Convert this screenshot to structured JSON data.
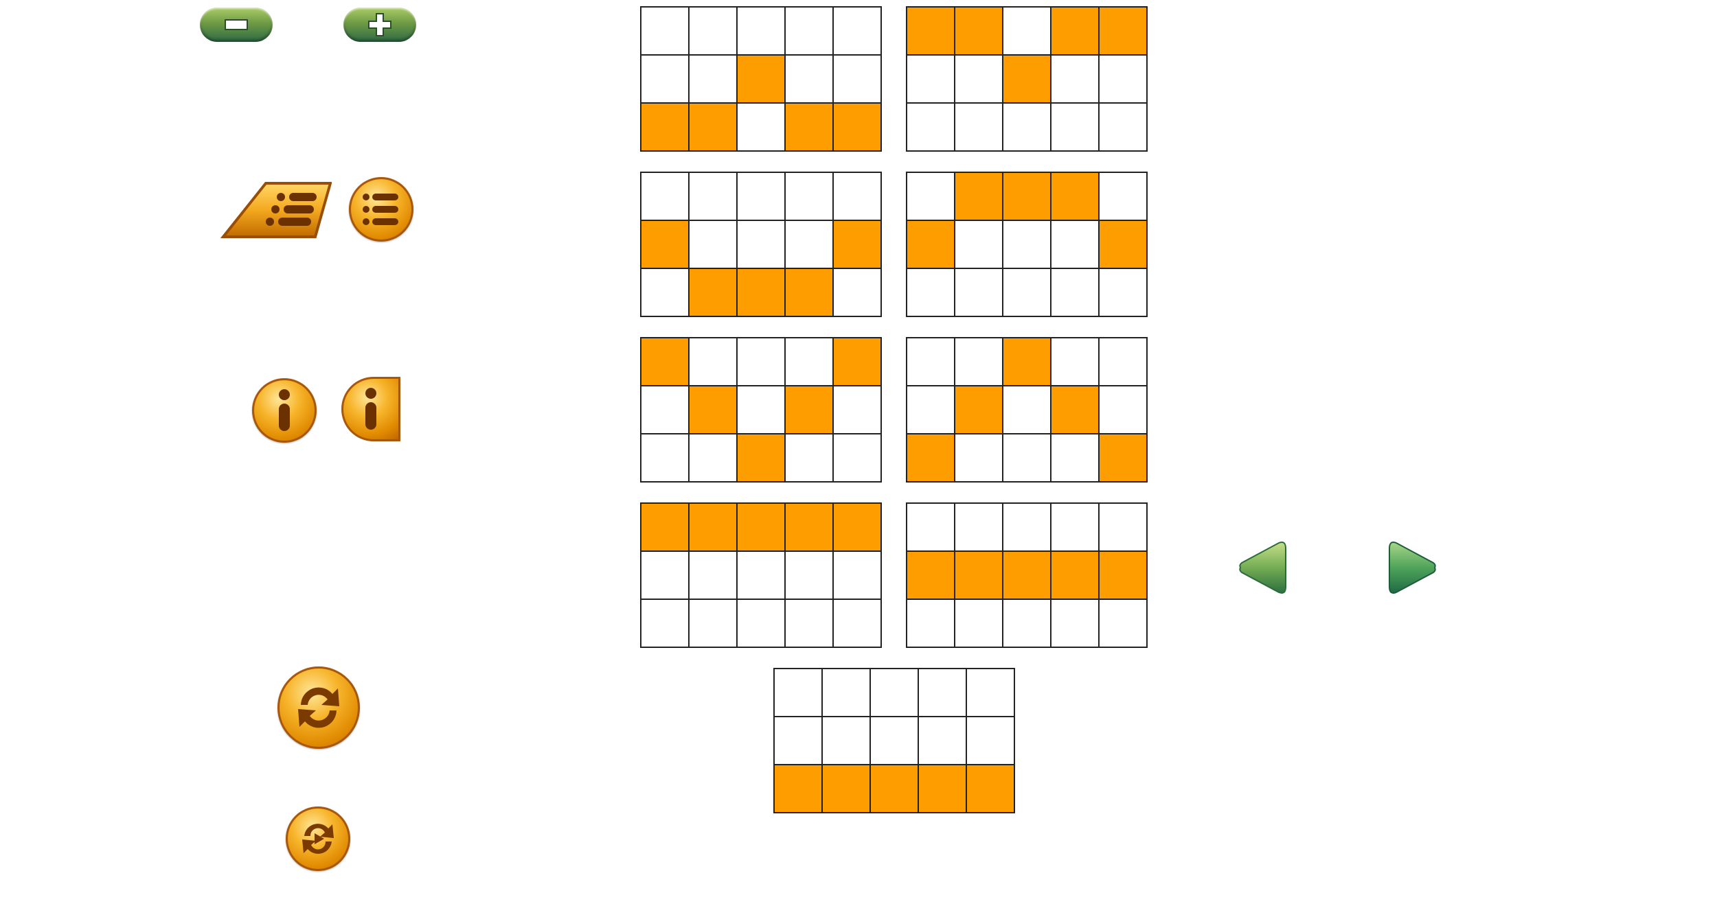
{
  "colors": {
    "filled": "#fe9d00",
    "empty": "#ffffff",
    "grid_line": "#222222",
    "nav_green": "#4e9a4a",
    "orb_orange": "#f3a323"
  },
  "controls": {
    "zoom_out": {
      "icon": "minus-icon"
    },
    "zoom_in": {
      "icon": "plus-icon"
    },
    "menu_tab": {
      "icon": "list-icon"
    },
    "menu_round": {
      "icon": "list-icon"
    },
    "info_round": {
      "icon": "info-icon"
    },
    "info_tab": {
      "icon": "info-icon"
    },
    "refresh_large": {
      "icon": "refresh-icon"
    },
    "refresh_small": {
      "icon": "refresh-icon"
    },
    "prev": {
      "icon": "arrow-left-icon"
    },
    "next": {
      "icon": "arrow-right-icon"
    }
  },
  "paylines": [
    {
      "id": 1,
      "rows": [
        [
          0,
          0,
          0,
          0,
          0
        ],
        [
          0,
          0,
          1,
          0,
          0
        ],
        [
          1,
          1,
          0,
          1,
          1
        ]
      ]
    },
    {
      "id": 2,
      "rows": [
        [
          1,
          1,
          0,
          1,
          1
        ],
        [
          0,
          0,
          1,
          0,
          0
        ],
        [
          0,
          0,
          0,
          0,
          0
        ]
      ]
    },
    {
      "id": 3,
      "rows": [
        [
          0,
          0,
          0,
          0,
          0
        ],
        [
          1,
          0,
          0,
          0,
          1
        ],
        [
          0,
          1,
          1,
          1,
          0
        ]
      ]
    },
    {
      "id": 4,
      "rows": [
        [
          0,
          1,
          1,
          1,
          0
        ],
        [
          1,
          0,
          0,
          0,
          1
        ],
        [
          0,
          0,
          0,
          0,
          0
        ]
      ]
    },
    {
      "id": 5,
      "rows": [
        [
          1,
          0,
          0,
          0,
          1
        ],
        [
          0,
          1,
          0,
          1,
          0
        ],
        [
          0,
          0,
          1,
          0,
          0
        ]
      ]
    },
    {
      "id": 6,
      "rows": [
        [
          0,
          0,
          1,
          0,
          0
        ],
        [
          0,
          1,
          0,
          1,
          0
        ],
        [
          1,
          0,
          0,
          0,
          1
        ]
      ]
    },
    {
      "id": 7,
      "rows": [
        [
          1,
          1,
          1,
          1,
          1
        ],
        [
          0,
          0,
          0,
          0,
          0
        ],
        [
          0,
          0,
          0,
          0,
          0
        ]
      ]
    },
    {
      "id": 8,
      "rows": [
        [
          0,
          0,
          0,
          0,
          0
        ],
        [
          1,
          1,
          1,
          1,
          1
        ],
        [
          0,
          0,
          0,
          0,
          0
        ]
      ]
    },
    {
      "id": 9,
      "rows": [
        [
          0,
          0,
          0,
          0,
          0
        ],
        [
          0,
          0,
          0,
          0,
          0
        ],
        [
          1,
          1,
          1,
          1,
          1
        ]
      ]
    }
  ]
}
